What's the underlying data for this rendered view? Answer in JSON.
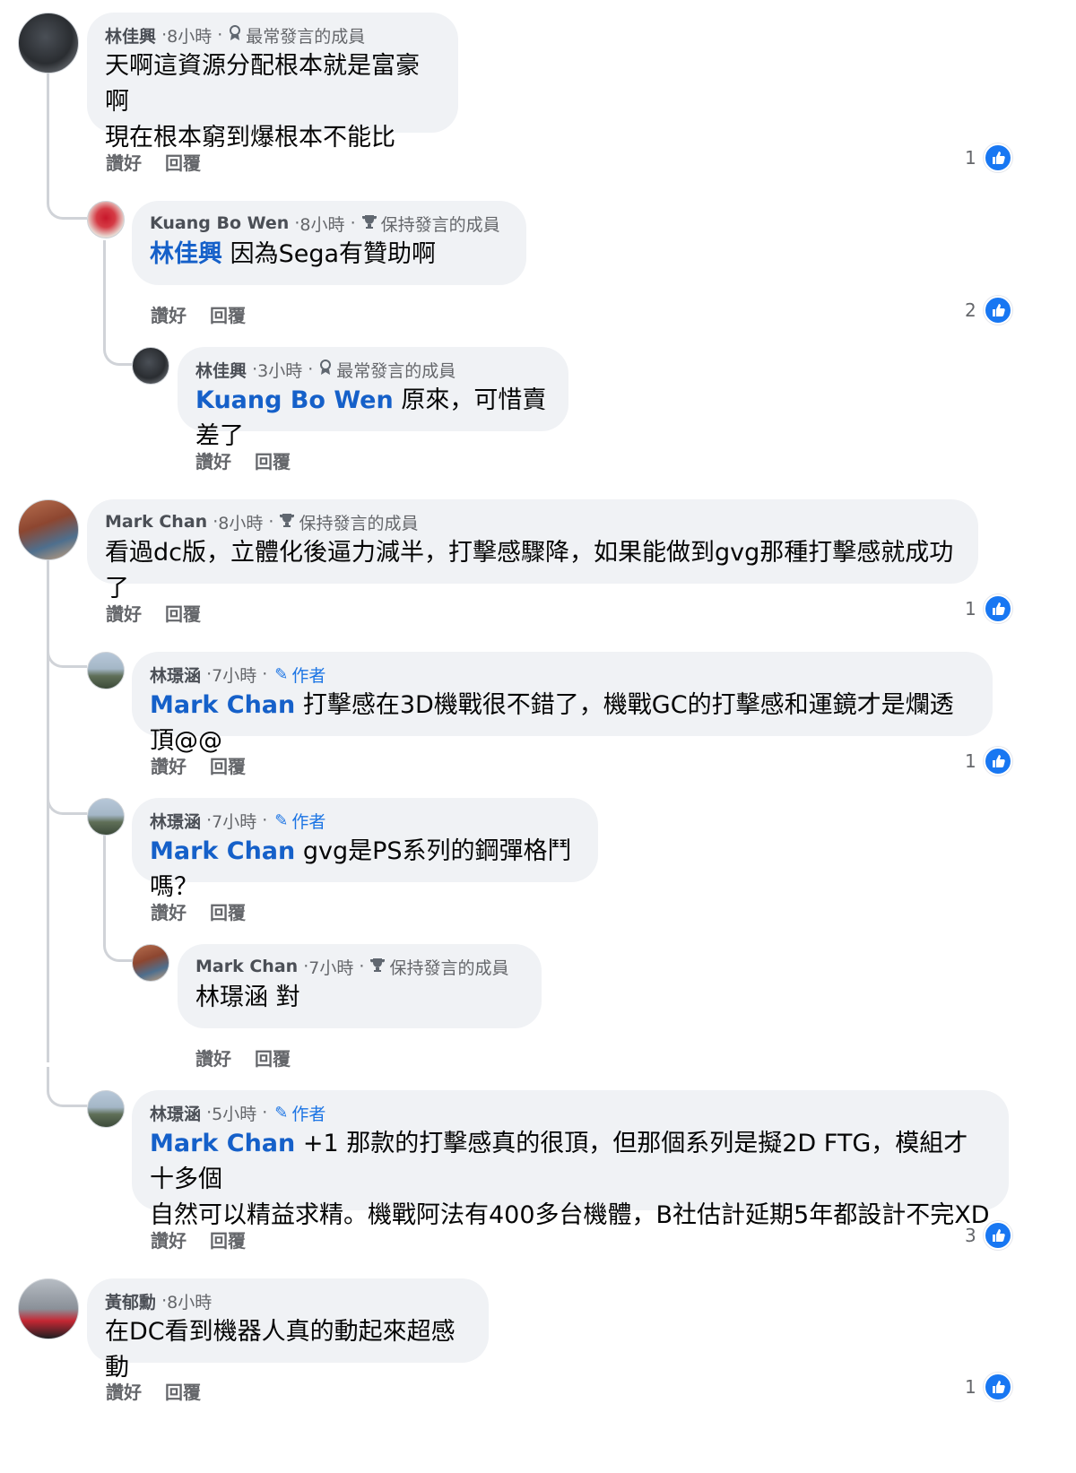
{
  "comments": [
    {
      "author": "林佳興",
      "time": "8小時",
      "badge": "最常發言的成員",
      "text": "天啊這資源分配根本就是富豪啊",
      "text2": "現在根本窮到爆根本不能比",
      "like_label": "讚好",
      "reply_label": "回覆",
      "likes": "1"
    },
    {
      "author": "Kuang Bo Wen",
      "time": "8小時",
      "badge": "保持發言的成員",
      "mention": "林佳興",
      "text": "因為Sega有贊助啊",
      "like_label": "讚好",
      "reply_label": "回覆",
      "likes": "2"
    },
    {
      "author": "林佳興",
      "time": "3小時",
      "badge": "最常發言的成員",
      "mention": "Kuang Bo Wen",
      "text": "原來，可惜賣差了",
      "like_label": "讚好",
      "reply_label": "回覆"
    },
    {
      "author": "Mark Chan",
      "time": "8小時",
      "badge": "保持發言的成員",
      "text": "看過dc版，立體化後逼力減半，打擊感驟降，如果能做到gvg那種打擊感就成功了",
      "like_label": "讚好",
      "reply_label": "回覆",
      "likes": "1"
    },
    {
      "author": "林璟涵",
      "time": "7小時",
      "badge": "作者",
      "mention": "Mark Chan",
      "text": "打擊感在3D機戰很不錯了，機戰GC的打擊感和運鏡才是爛透頂@@",
      "like_label": "讚好",
      "reply_label": "回覆",
      "likes": "1"
    },
    {
      "author": "林璟涵",
      "time": "7小時",
      "badge": "作者",
      "mention": "Mark Chan",
      "text": "gvg是PS系列的鋼彈格鬥嗎？",
      "like_label": "讚好",
      "reply_label": "回覆"
    },
    {
      "author": "Mark Chan",
      "time": "7小時",
      "badge": "保持發言的成員",
      "text": "林璟涵 對",
      "like_label": "讚好",
      "reply_label": "回覆"
    },
    {
      "author": "林璟涵",
      "time": "5小時",
      "badge": "作者",
      "mention": "Mark Chan",
      "text": "+1 那款的打擊感真的很頂，但那個系列是擬2D FTG，模組才十多個",
      "text2": "自然可以精益求精。機戰阿法有400多台機體，B社估計延期5年都設計不完XD",
      "like_label": "讚好",
      "reply_label": "回覆",
      "likes": "3"
    },
    {
      "author": "黃郁勳",
      "time": "8小時",
      "text": "在DC看到機器人真的動起來超感動",
      "like_label": "讚好",
      "reply_label": "回覆",
      "likes": "1"
    }
  ],
  "separator": "·",
  "icons": {
    "member_badge": "badge-icon",
    "trophy": "trophy-icon",
    "author": "pencil-icon",
    "like": "thumbs-up-icon"
  },
  "colors": {
    "bubble": "#f0f2f5",
    "mention": "#1560c9",
    "like_blue": "#1877f2",
    "secondary_text": "#65676b"
  }
}
